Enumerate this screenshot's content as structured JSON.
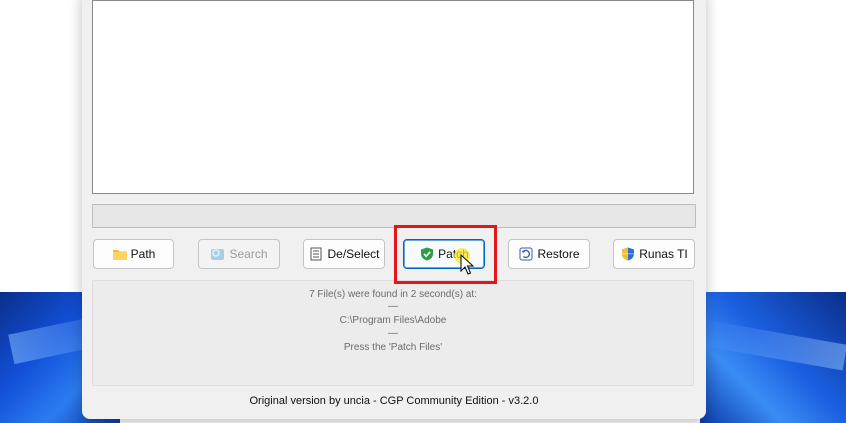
{
  "buttons": {
    "path": "Path",
    "search": "Search",
    "deselect": "De/Select",
    "patch": "Patch",
    "restore": "Restore",
    "runas": "Runas TI"
  },
  "info": {
    "found": "7 File(s) were found in 2 second(s) at:",
    "sep1": "—",
    "path": "C:\\Program Files\\Adobe",
    "sep2": "—",
    "hint": "Press the 'Patch Files'"
  },
  "footer": {
    "credits": "Original version by uncia - CGP Community Edition - v3.2.0"
  },
  "colors": {
    "highlight": "#e3161c",
    "accent": "#0067c0",
    "window_bg": "#f0f0f0"
  },
  "icons": {
    "path": "folder-icon",
    "search": "search-icon",
    "deselect": "checklist-icon",
    "patch": "shield-check-icon",
    "restore": "restore-icon",
    "runas": "uac-shield-icon"
  }
}
